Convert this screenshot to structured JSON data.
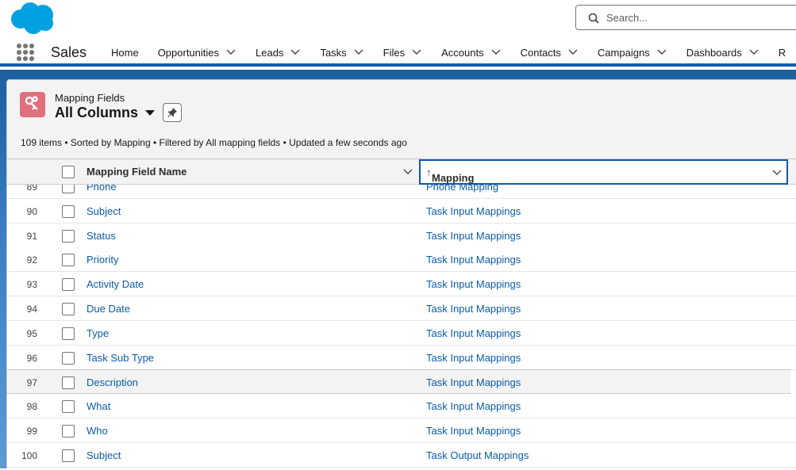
{
  "header": {
    "search_placeholder": "Search..."
  },
  "nav": {
    "app_name": "Sales",
    "items": [
      {
        "label": "Home",
        "dropdown": false
      },
      {
        "label": "Opportunities",
        "dropdown": true
      },
      {
        "label": "Leads",
        "dropdown": true
      },
      {
        "label": "Tasks",
        "dropdown": true
      },
      {
        "label": "Files",
        "dropdown": true
      },
      {
        "label": "Accounts",
        "dropdown": true
      },
      {
        "label": "Contacts",
        "dropdown": true
      },
      {
        "label": "Campaigns",
        "dropdown": true
      },
      {
        "label": "Dashboards",
        "dropdown": true
      },
      {
        "label": "R",
        "dropdown": false
      }
    ]
  },
  "list": {
    "object_label": "Mapping Fields",
    "view_name": "All Columns",
    "meta": "109 items • Sorted by Mapping • Filtered by All mapping fields • Updated a few seconds ago",
    "columns": [
      "Mapping Field Name",
      "Mapping"
    ],
    "sort_indicator": "↑",
    "rows": [
      {
        "num": "89",
        "name": "Phone",
        "mapping": "Phone Mapping"
      },
      {
        "num": "90",
        "name": "Subject",
        "mapping": "Task Input Mappings"
      },
      {
        "num": "91",
        "name": "Status",
        "mapping": "Task Input Mappings"
      },
      {
        "num": "92",
        "name": "Priority",
        "mapping": "Task Input Mappings"
      },
      {
        "num": "93",
        "name": "Activity Date",
        "mapping": "Task Input Mappings"
      },
      {
        "num": "94",
        "name": "Due Date",
        "mapping": "Task Input Mappings"
      },
      {
        "num": "95",
        "name": "Type",
        "mapping": "Task Input Mappings"
      },
      {
        "num": "96",
        "name": "Task Sub Type",
        "mapping": "Task Input Mappings"
      },
      {
        "num": "97",
        "name": "Description",
        "mapping": "Task Input Mappings",
        "hover": true
      },
      {
        "num": "98",
        "name": "What",
        "mapping": "Task Input Mappings"
      },
      {
        "num": "99",
        "name": "Who",
        "mapping": "Task Input Mappings"
      },
      {
        "num": "100",
        "name": "Subject",
        "mapping": "Task Output Mappings"
      }
    ]
  },
  "colors": {
    "brand": "#00a1e0",
    "link": "#0b5cab",
    "object_icon": "#e0707c",
    "band": "#0b5cab"
  }
}
